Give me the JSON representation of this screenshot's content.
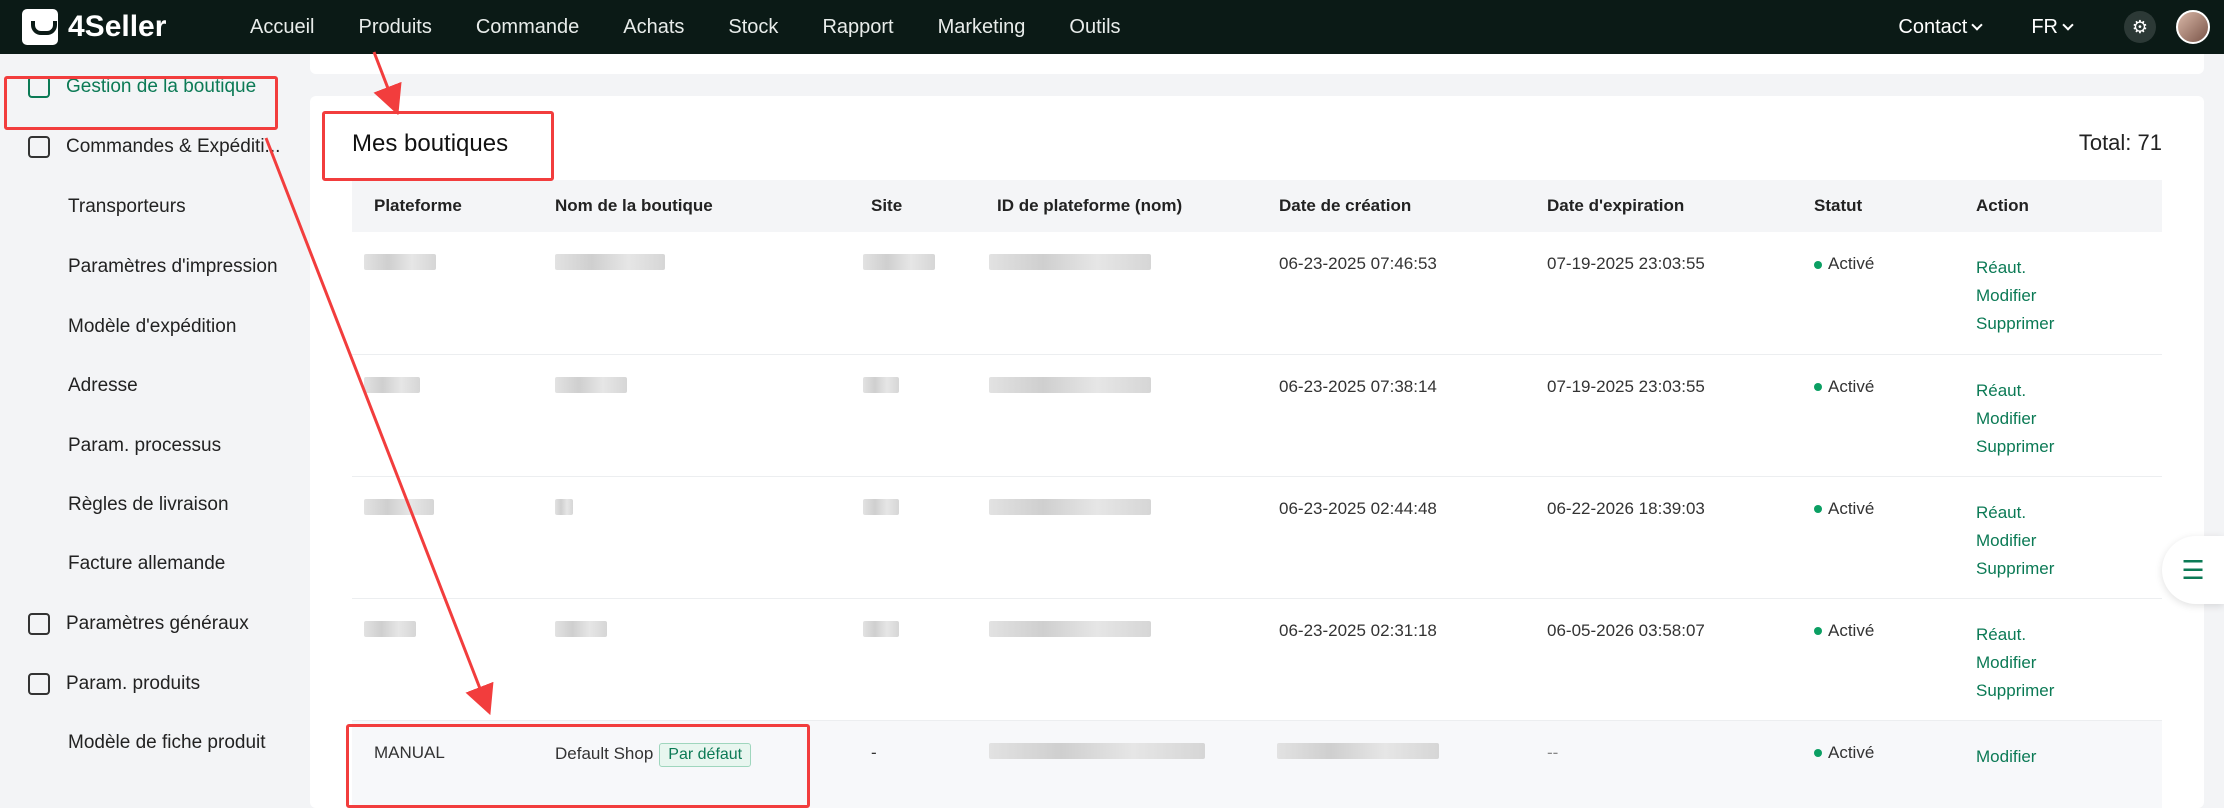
{
  "brand": {
    "name": "4Seller"
  },
  "nav": [
    "Accueil",
    "Produits",
    "Commande",
    "Achats",
    "Stock",
    "Rapport",
    "Marketing",
    "Outils"
  ],
  "top_right": {
    "contact": "Contact",
    "lang": "FR"
  },
  "sidebar": {
    "items": [
      {
        "label": "Gestion de la boutique",
        "icon": "shop-icon",
        "active": true
      },
      {
        "label": "Commandes & Expéditi...",
        "icon": "clipboard-icon"
      },
      {
        "label": "Transporteurs"
      },
      {
        "label": "Paramètres d'impression"
      },
      {
        "label": "Modèle d'expédition"
      },
      {
        "label": "Adresse"
      },
      {
        "label": "Param. processus"
      },
      {
        "label": "Règles de livraison"
      },
      {
        "label": "Facture allemande"
      },
      {
        "label": "Paramètres généraux",
        "icon": "printer-icon"
      },
      {
        "label": "Param. produits",
        "icon": "upload-box-icon"
      },
      {
        "label": "Modèle de fiche produit"
      }
    ]
  },
  "main": {
    "title": "Mes boutiques",
    "total": "Total: 71",
    "columns": [
      "Plateforme",
      "Nom de la boutique",
      "Site",
      "ID de plateforme (nom)",
      "Date de création",
      "Date d'expiration",
      "Statut",
      "Action"
    ],
    "rows": [
      {
        "created": "06-23-2025 07:46:53",
        "expires": "07-19-2025 23:03:55",
        "status": "Activé",
        "actions": [
          "Réaut.",
          "Modifier",
          "Supprimer"
        ]
      },
      {
        "created": "06-23-2025 07:38:14",
        "expires": "07-19-2025 23:03:55",
        "status": "Activé",
        "actions": [
          "Réaut.",
          "Modifier",
          "Supprimer"
        ]
      },
      {
        "created": "06-23-2025 02:44:48",
        "expires": "06-22-2026 18:39:03",
        "status": "Activé",
        "actions": [
          "Réaut.",
          "Modifier",
          "Supprimer"
        ]
      },
      {
        "created": "06-23-2025 02:31:18",
        "expires": "06-05-2026 03:58:07",
        "status": "Activé",
        "actions": [
          "Réaut.",
          "Modifier",
          "Supprimer"
        ]
      }
    ],
    "last_row": {
      "platform": "MANUAL",
      "shop": "Default Shop",
      "tag": "Par défaut",
      "site": "-",
      "expires": "--",
      "status": "Activé",
      "action": "Modifier"
    }
  },
  "colors": {
    "accent": "#0b7a55",
    "annotation": "#f23d3d",
    "topbar": "#0b1a16"
  }
}
